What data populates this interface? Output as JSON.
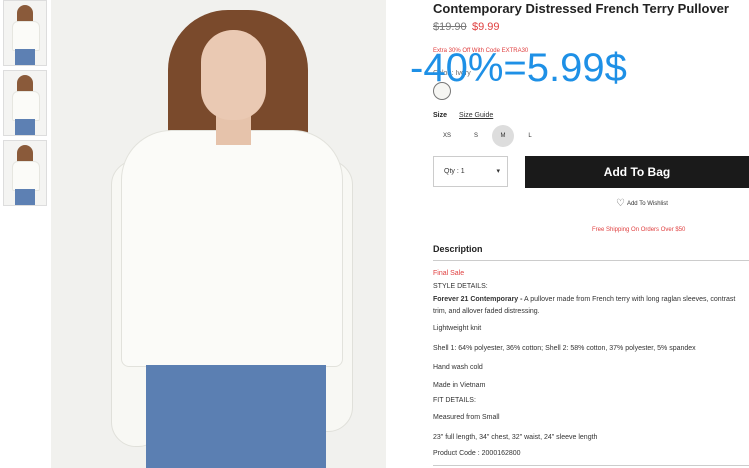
{
  "product": {
    "title": "Contemporary Distressed French Terry Pullover",
    "price_old": "$19.90",
    "price_new": "$9.99",
    "promo": "Extra 30% Off With Code EXTRA30",
    "color_label": "Color : Ivory",
    "overlay_text": "-40%=5.99$",
    "swatch_color": "#f6f6f3"
  },
  "sizes": {
    "label": "Size",
    "guide": "Size Guide",
    "options": [
      "XS",
      "S",
      "M",
      "L"
    ],
    "selected": "M"
  },
  "cart": {
    "qty": "Qty : 1",
    "caret": "▾",
    "add_to_bag": "Add To Bag",
    "wishlist": "Add To Wishlist",
    "heart_glyph": "♡",
    "shipping": "Free Shipping On Orders Over $50"
  },
  "description": {
    "heading": "Description",
    "final_sale": "Final Sale",
    "style_details": "STYLE DETAILS:",
    "brand": "Forever 21 Contemporary -",
    "body": " A pullover made from French terry with long raglan sleeves, contrast trim, and allover faded distressing.",
    "knit": "Lightweight knit",
    "shell": "Shell 1: 64% polyester, 36% cotton; Shell 2: 58% cotton, 37% polyester, 5% spandex",
    "wash": "Hand wash cold",
    "origin": "Made in Vietnam",
    "fit_details": "FIT DETAILS:",
    "measured": "Measured from Small",
    "measurements": "23\" full length, 34\" chest, 32\" waist, 24\" sleeve length",
    "product_code": "Product Code : 2000162800"
  },
  "colors": {
    "accent": "#1e90e6",
    "sale": "#e04040",
    "button": "#1a1a1a"
  }
}
